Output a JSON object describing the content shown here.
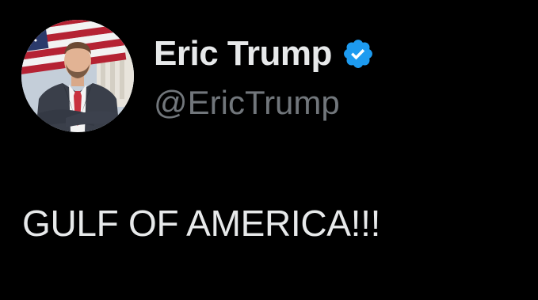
{
  "tweet": {
    "author": {
      "display_name": "Eric Trump",
      "handle": "@EricTrump",
      "verified": true,
      "avatar": "profile-photo-man-in-suit-with-american-flag"
    },
    "text": "GULF OF AMERICA!!!"
  },
  "colors": {
    "background": "#000000",
    "primary_text": "#e7e9ea",
    "secondary_text": "#71767b",
    "verified_blue": "#1d9bf0"
  }
}
